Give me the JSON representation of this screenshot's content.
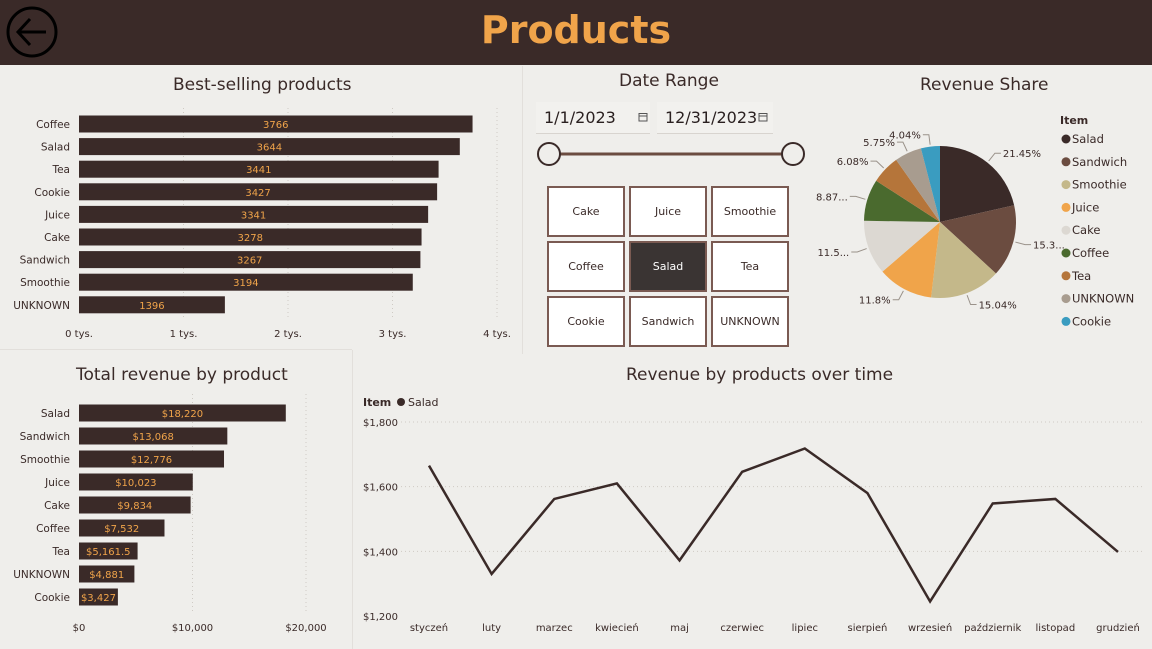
{
  "page": {
    "title": "Products"
  },
  "best_selling": {
    "title": "Best-selling products",
    "chart_data": {
      "type": "bar",
      "orientation": "horizontal",
      "categories": [
        "Coffee",
        "Salad",
        "Tea",
        "Cookie",
        "Juice",
        "Cake",
        "Sandwich",
        "Smoothie",
        "UNKNOWN"
      ],
      "values": [
        3766,
        3644,
        3441,
        3427,
        3341,
        3278,
        3267,
        3194,
        1396
      ],
      "data_labels": [
        "3766",
        "3644",
        "3441",
        "3427",
        "3341",
        "3278",
        "3267",
        "3194",
        "1396"
      ],
      "xlim": [
        0,
        4000
      ],
      "xticks": [
        "0 tys.",
        "1 tys.",
        "2 tys.",
        "3 tys.",
        "4 tys."
      ],
      "grid": true,
      "bar_color": "#3a2a28",
      "label_color": "#f0a44a"
    }
  },
  "date_range": {
    "title": "Date Range",
    "start": "1/1/2023",
    "end": "12/31/2023",
    "slider_start": 0,
    "slider_end": 1
  },
  "item_slicer": {
    "tiles": [
      "Cake",
      "Juice",
      "Smoothie",
      "Coffee",
      "Salad",
      "Tea",
      "Cookie",
      "Sandwich",
      "UNKNOWN"
    ],
    "selected": "Salad"
  },
  "revenue_share": {
    "title": "Revenue Share",
    "legend_title": "Item",
    "chart_data": {
      "type": "pie",
      "categories": [
        "Salad",
        "Sandwich",
        "Smoothie",
        "Juice",
        "Cake",
        "Coffee",
        "Tea",
        "UNKNOWN",
        "Cookie"
      ],
      "values": [
        21.45,
        15.38,
        15.04,
        11.8,
        11.58,
        8.87,
        6.08,
        5.75,
        4.04
      ],
      "data_labels": [
        "21.45%",
        "15.3...",
        "15.04%",
        "11.8%",
        "11.5...",
        "8.87...",
        "6.08%",
        "5.75%",
        "4.04%"
      ],
      "colors": [
        "#3a2a28",
        "#6b4c40",
        "#c4b88a",
        "#f0a44a",
        "#dcd8d2",
        "#4a6a2e",
        "#b5753a",
        "#a89c8f",
        "#3a9cc0"
      ],
      "legend_position": "right"
    }
  },
  "total_revenue": {
    "title": "Total revenue by product",
    "chart_data": {
      "type": "bar",
      "orientation": "horizontal",
      "categories": [
        "Salad",
        "Sandwich",
        "Smoothie",
        "Juice",
        "Cake",
        "Coffee",
        "Tea",
        "UNKNOWN",
        "Cookie"
      ],
      "values": [
        18220,
        13068,
        12776,
        10023,
        9834,
        7532,
        5161.5,
        4881,
        3427
      ],
      "data_labels": [
        "$18,220",
        "$13,068",
        "$12,776",
        "$10,023",
        "$9,834",
        "$7,532",
        "$5,161.5",
        "$4,881",
        "$3,427"
      ],
      "xlim": [
        0,
        20000
      ],
      "xticks": [
        "$0",
        "$10,000",
        "$20,000"
      ],
      "grid": true,
      "bar_color": "#3a2a28",
      "label_color": "#f0a44a"
    }
  },
  "revenue_over_time": {
    "title": "Revenue by products over time",
    "legend_title": "Item",
    "chart_data": {
      "type": "line",
      "x": [
        "styczeń",
        "luty",
        "marzec",
        "kwiecień",
        "maj",
        "czerwiec",
        "lipiec",
        "sierpień",
        "wrzesień",
        "październik",
        "listopad",
        "grudzień"
      ],
      "series": [
        {
          "name": "Salad",
          "values": [
            1665,
            1330,
            1562,
            1610,
            1372,
            1646,
            1718,
            1580,
            1245,
            1548,
            1562,
            1398
          ],
          "color": "#3a2a28"
        }
      ],
      "ylim": [
        1200,
        1800
      ],
      "yticks": [
        "$1,200",
        "$1,400",
        "$1,600",
        "$1,800"
      ],
      "grid": true
    }
  },
  "colors": {
    "header_bg": "#3a2a28",
    "accent": "#f0a44a",
    "page_bg": "#efeeeb"
  }
}
